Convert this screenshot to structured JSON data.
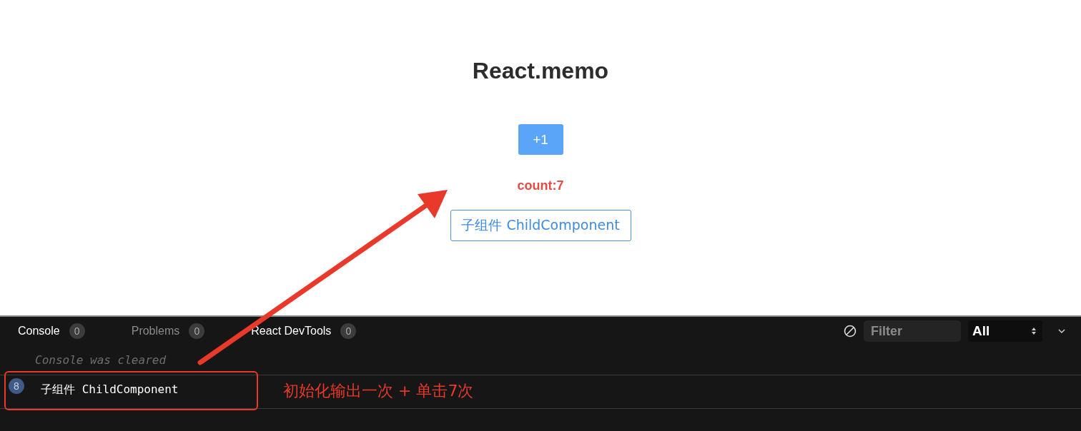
{
  "page": {
    "title": "React.memo",
    "increment_button": "+1",
    "count": "count:7",
    "child_button": "子组件 ChildComponent"
  },
  "devtools": {
    "tabs": [
      {
        "label": "Console",
        "count": "0",
        "dimmed": false
      },
      {
        "label": "Problems",
        "count": "0",
        "dimmed": true
      },
      {
        "label": "React DevTools",
        "count": "0",
        "dimmed": false
      }
    ],
    "filter": {
      "placeholder": "Filter"
    },
    "level_select": "All",
    "cleared_message": "Console was cleared",
    "logs": [
      {
        "repeat": "8",
        "message": "子组件 ChildComponent"
      }
    ]
  },
  "annotation": {
    "note": "初始化输出一次 + 单击7次"
  }
}
